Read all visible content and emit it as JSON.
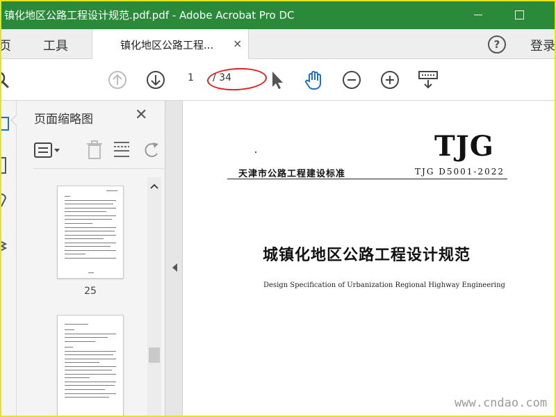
{
  "window": {
    "title": "镇化地区公路工程设计规范.pdf.pdf - Adobe Acrobat Pro DC"
  },
  "tabs": {
    "home_label": "主页",
    "tools_label": "工具",
    "document_tab_label": "镇化地区公路工程...",
    "close_glyph": "×",
    "help_glyph": "?",
    "login_label": "登录"
  },
  "toolbar": {
    "current_page": "1",
    "total_pages": "/ 34"
  },
  "thumbnails_panel": {
    "title": "页面缩略图",
    "close_glyph": "✕",
    "thumbnails": [
      {
        "page_label": "25"
      }
    ]
  },
  "document": {
    "brand": "TJG",
    "standard_name": "天津市公路工程建设标准",
    "standard_code": "TJG D5001-2022",
    "title": "城镇化地区公路工程设计规范",
    "subtitle": "Design Specification of Urbanization Regional Highway Engineering"
  },
  "watermarks": {
    "site": "www.cndao.com"
  },
  "colors": {
    "titlebar": "#2a8a3a",
    "frame": "#e8e31a",
    "annotation": "#e0201a",
    "icon_blue": "#1f6fc5"
  }
}
